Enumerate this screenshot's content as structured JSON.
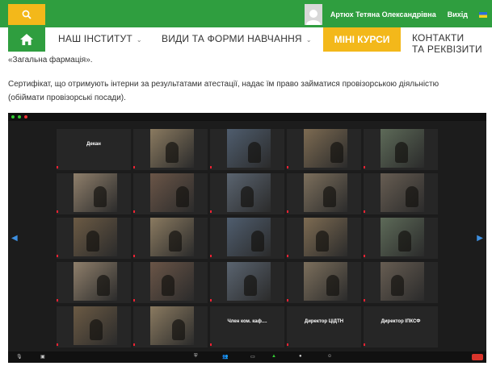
{
  "header": {
    "user_name": "Артюх Тетяна Олександрівна",
    "logout_label": "Вихід"
  },
  "nav": {
    "items": [
      {
        "label": "НАШ ІНСТИТУТ"
      },
      {
        "label": "ВИДИ ТА ФОРМИ НАВЧАННЯ"
      }
    ],
    "active_label": "МІНІ КУРСИ",
    "contacts_line1": "КОНТАКТИ",
    "contacts_line2": "ТА РЕКВІЗИТИ"
  },
  "content": {
    "line1": "«Загальна фармація».",
    "line2": "Сертифікат, що отримують інтерни за результатами атестації, надає їм право займатися провізорською діяльністю",
    "line3": "(обіймати провізорські посади)."
  },
  "zoom": {
    "tiles": [
      {
        "text": "Декан"
      },
      {
        "text": ""
      },
      {
        "text": ""
      },
      {
        "text": ""
      },
      {
        "text": ""
      },
      {
        "text": ""
      },
      {
        "text": ""
      },
      {
        "text": ""
      },
      {
        "text": ""
      },
      {
        "text": ""
      },
      {
        "text": ""
      },
      {
        "text": ""
      },
      {
        "text": ""
      },
      {
        "text": ""
      },
      {
        "text": ""
      },
      {
        "text": ""
      },
      {
        "text": ""
      },
      {
        "text": ""
      },
      {
        "text": ""
      },
      {
        "text": ""
      },
      {
        "text": ""
      },
      {
        "text": ""
      },
      {
        "text": "Член ком. каф...."
      },
      {
        "text": "Директор ЦІДТН"
      },
      {
        "text": "Директор ІПКСФ"
      }
    ],
    "colors": {
      "background": "#1c1c1c",
      "tile": "#262626"
    }
  },
  "colors": {
    "brand_green": "#2f9e3f",
    "accent_yellow": "#f3b81a"
  }
}
